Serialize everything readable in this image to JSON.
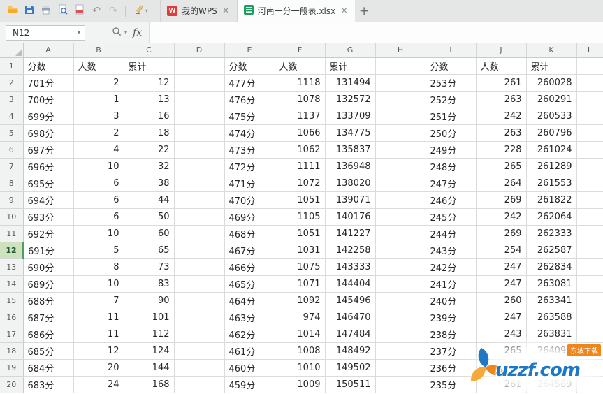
{
  "glyphs": {
    "undo": "↶",
    "redo": "↷",
    "caret": "▾",
    "close": "×",
    "plus": "+"
  },
  "toolbar": {
    "tabs": [
      {
        "label": "我的WPS"
      },
      {
        "label": "河南一分一段表.xlsx"
      }
    ]
  },
  "formula_bar": {
    "name_box_value": "N12",
    "fx_label": "fx"
  },
  "grid": {
    "selected_row": 12,
    "columns": [
      "A",
      "B",
      "C",
      "D",
      "E",
      "F",
      "G",
      "H",
      "I",
      "J",
      "K",
      "L"
    ],
    "rows": [
      [
        "分数",
        "人数",
        "累计",
        "",
        "分数",
        "人数",
        "累计",
        "",
        "分数",
        "人数",
        "累计",
        ""
      ],
      [
        "701分",
        "2",
        "12",
        "",
        "477分",
        "1118",
        "131494",
        "",
        "253分",
        "261",
        "260028",
        ""
      ],
      [
        "700分",
        "1",
        "13",
        "",
        "476分",
        "1078",
        "132572",
        "",
        "252分",
        "263",
        "260291",
        ""
      ],
      [
        "699分",
        "3",
        "16",
        "",
        "475分",
        "1137",
        "133709",
        "",
        "251分",
        "242",
        "260533",
        ""
      ],
      [
        "698分",
        "2",
        "18",
        "",
        "474分",
        "1066",
        "134775",
        "",
        "250分",
        "263",
        "260796",
        ""
      ],
      [
        "697分",
        "4",
        "22",
        "",
        "473分",
        "1062",
        "135837",
        "",
        "249分",
        "228",
        "261024",
        ""
      ],
      [
        "696分",
        "10",
        "32",
        "",
        "472分",
        "1111",
        "136948",
        "",
        "248分",
        "265",
        "261289",
        ""
      ],
      [
        "695分",
        "6",
        "38",
        "",
        "471分",
        "1072",
        "138020",
        "",
        "247分",
        "264",
        "261553",
        ""
      ],
      [
        "694分",
        "6",
        "44",
        "",
        "470分",
        "1051",
        "139071",
        "",
        "246分",
        "269",
        "261822",
        ""
      ],
      [
        "693分",
        "6",
        "50",
        "",
        "469分",
        "1105",
        "140176",
        "",
        "245分",
        "242",
        "262064",
        ""
      ],
      [
        "692分",
        "10",
        "60",
        "",
        "468分",
        "1051",
        "141227",
        "",
        "244分",
        "269",
        "262333",
        ""
      ],
      [
        "691分",
        "5",
        "65",
        "",
        "467分",
        "1031",
        "142258",
        "",
        "243分",
        "254",
        "262587",
        ""
      ],
      [
        "690分",
        "8",
        "73",
        "",
        "466分",
        "1075",
        "143333",
        "",
        "242分",
        "247",
        "262834",
        ""
      ],
      [
        "689分",
        "10",
        "83",
        "",
        "465分",
        "1071",
        "144404",
        "",
        "241分",
        "247",
        "263081",
        ""
      ],
      [
        "688分",
        "7",
        "90",
        "",
        "464分",
        "1092",
        "145496",
        "",
        "240分",
        "260",
        "263341",
        ""
      ],
      [
        "687分",
        "11",
        "101",
        "",
        "463分",
        "974",
        "146470",
        "",
        "239分",
        "247",
        "263588",
        ""
      ],
      [
        "686分",
        "11",
        "112",
        "",
        "462分",
        "1014",
        "147484",
        "",
        "238分",
        "243",
        "263831",
        ""
      ],
      [
        "685分",
        "12",
        "124",
        "",
        "461分",
        "1008",
        "148492",
        "",
        "237分",
        "265",
        "264096",
        ""
      ],
      [
        "684分",
        "20",
        "144",
        "",
        "460分",
        "1010",
        "149502",
        "",
        "236分",
        "",
        "",
        ""
      ],
      [
        "683分",
        "24",
        "168",
        "",
        "459分",
        "1009",
        "150511",
        "",
        "235分",
        "261",
        "264569",
        ""
      ]
    ]
  },
  "watermark": {
    "brand": "uzzf.com",
    "badge": "东坡下载"
  },
  "colors": {
    "brand_green": "#1f9d61",
    "wps_red": "#e23c39",
    "watermark_blue": "#1d78c5",
    "watermark_orange": "#f08519"
  }
}
